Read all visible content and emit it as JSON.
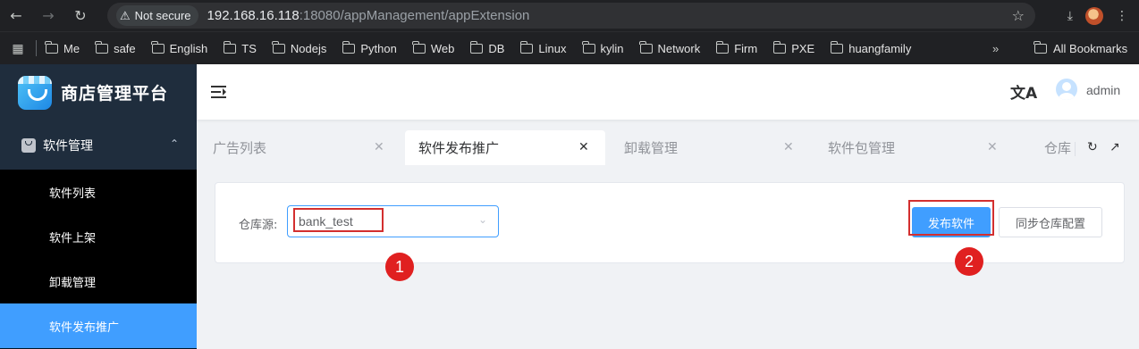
{
  "browser": {
    "security_label": "Not secure",
    "url_host": "192.168.16.118",
    "url_path": ":18080/appManagement/appExtension",
    "bookmarks": [
      "Me",
      "safe",
      "English",
      "TS",
      "Nodejs",
      "Python",
      "Web",
      "DB",
      "Linux",
      "kylin",
      "Network",
      "Firm",
      "PXE",
      "huangfamily"
    ],
    "bookmarks_overflow": "»",
    "all_bookmarks": "All Bookmarks"
  },
  "sidebar": {
    "brand_title": "商店管理平台",
    "group_label": "软件管理",
    "items": [
      {
        "label": "软件列表",
        "active": false
      },
      {
        "label": "软件上架",
        "active": false
      },
      {
        "label": "卸载管理",
        "active": false
      },
      {
        "label": "软件发布推广",
        "active": true
      }
    ]
  },
  "header": {
    "translate_icon": "文A",
    "username": "admin"
  },
  "tags": [
    {
      "label": "广告列表",
      "active": false
    },
    {
      "label": "软件发布推广",
      "active": true
    },
    {
      "label": "卸载管理",
      "active": false
    },
    {
      "label": "软件包管理",
      "active": false
    },
    {
      "label": "仓库",
      "active": false
    }
  ],
  "form": {
    "repo_label": "仓库源:",
    "repo_value": "bank_test",
    "publish_button": "发布软件",
    "sync_button": "同步仓库配置"
  },
  "annotations": {
    "step1": "1",
    "step2": "2",
    "highlight_color": "#d32f2f",
    "badge_color": "#e02020"
  },
  "colors": {
    "primary": "#409eff",
    "sidebar_bg": "#001529",
    "submenu_bg": "#000000"
  }
}
